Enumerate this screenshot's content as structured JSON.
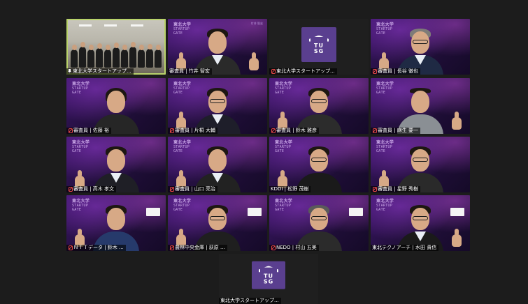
{
  "meeting": {
    "tiles": [
      {
        "id": "t1",
        "label": "東北大学スタートアップ...",
        "pinned": true,
        "muted": false,
        "kind": "room",
        "active": true
      },
      {
        "id": "t2",
        "label": "審査員 | 竹井 智宏",
        "pinned": false,
        "muted": false,
        "kind": "person"
      },
      {
        "id": "t3",
        "label": "東北大学スタートアップ...",
        "pinned": false,
        "muted": true,
        "kind": "logo"
      },
      {
        "id": "t4",
        "label": "審査員 | 長谷 徹也",
        "pinned": false,
        "muted": true,
        "kind": "person"
      },
      {
        "id": "t5",
        "label": "審査員 | 佐藤 裕",
        "pinned": false,
        "muted": true,
        "kind": "person"
      },
      {
        "id": "t6",
        "label": "審査員 | 片桐 大輔",
        "pinned": false,
        "muted": true,
        "kind": "person"
      },
      {
        "id": "t7",
        "label": "審査員 | 鈴木 雅彦",
        "pinned": false,
        "muted": true,
        "kind": "person"
      },
      {
        "id": "t8",
        "label": "審査員 | 麻生 要一",
        "pinned": false,
        "muted": true,
        "kind": "person"
      },
      {
        "id": "t9",
        "label": "審査員 | 高木 孝文",
        "pinned": false,
        "muted": true,
        "kind": "person"
      },
      {
        "id": "t10",
        "label": "審査員 | 山口 亮治",
        "pinned": false,
        "muted": true,
        "kind": "person"
      },
      {
        "id": "t11",
        "label": "KDDI | 松野 茂樹",
        "pinned": false,
        "muted": false,
        "kind": "person"
      },
      {
        "id": "t12",
        "label": "審査員 | 星野 秀樹",
        "pinned": false,
        "muted": true,
        "kind": "person"
      },
      {
        "id": "t13",
        "label": "ＮＴＴデータ | 鈴木 ...",
        "pinned": false,
        "muted": true,
        "kind": "person"
      },
      {
        "id": "t14",
        "label": "農林中央金庫 | 荻原 ...",
        "pinned": false,
        "muted": true,
        "kind": "person"
      },
      {
        "id": "t15",
        "label": "NEDO | 村山 五美",
        "pinned": false,
        "muted": true,
        "kind": "person"
      },
      {
        "id": "t16",
        "label": "東北テクノアーチ | 水田 貴信",
        "pinned": false,
        "muted": false,
        "kind": "person"
      },
      {
        "id": "t17",
        "label": "東北大学スタートアップ...",
        "pinned": false,
        "muted": false,
        "kind": "logo"
      }
    ],
    "event_logo_text": "東北大学\nSTARTUP\nGATE DEMO",
    "tusg_text": "TU\nSG",
    "colors": {
      "active_border": "#b9d36b",
      "muted_red": "#e04646",
      "tile_purple": "#3a1466",
      "logo_purple": "#5a3f8f"
    }
  }
}
